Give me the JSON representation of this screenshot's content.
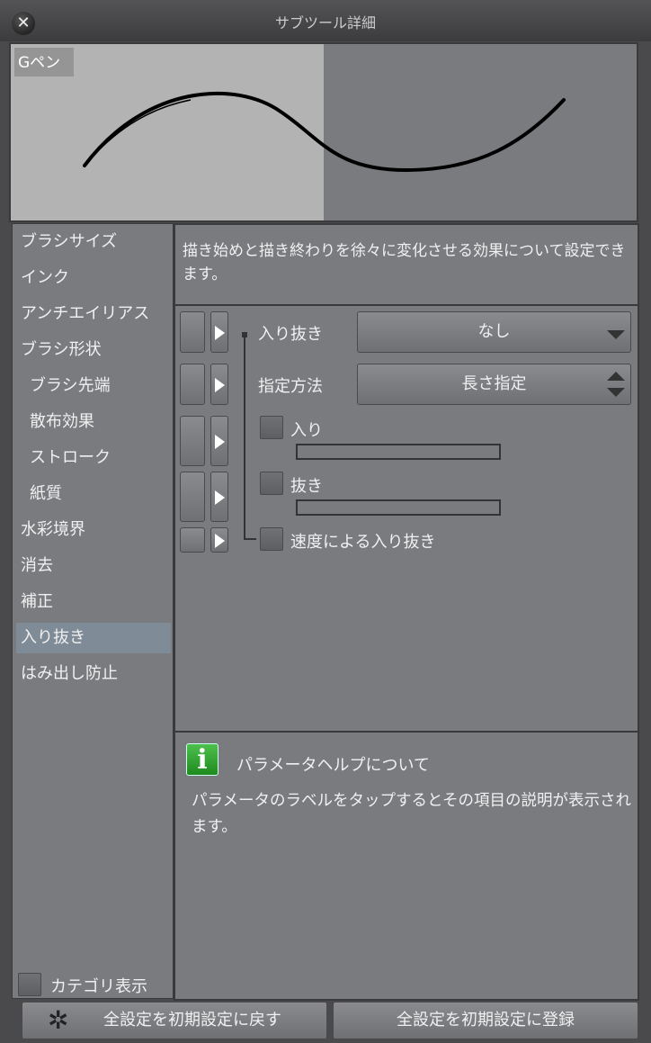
{
  "window": {
    "title": "サブツール詳細"
  },
  "preview": {
    "tool_name": "Gペン"
  },
  "sidebar": {
    "items": [
      {
        "label": "ブラシサイズ",
        "sub": false
      },
      {
        "label": "インク",
        "sub": false
      },
      {
        "label": "アンチエイリアス",
        "sub": false
      },
      {
        "label": "ブラシ形状",
        "sub": false
      },
      {
        "label": "ブラシ先端",
        "sub": true
      },
      {
        "label": "散布効果",
        "sub": true
      },
      {
        "label": "ストローク",
        "sub": true
      },
      {
        "label": "紙質",
        "sub": true
      },
      {
        "label": "水彩境界",
        "sub": false
      },
      {
        "label": "消去",
        "sub": false
      },
      {
        "label": "補正",
        "sub": false
      },
      {
        "label": "入り抜き",
        "sub": false,
        "selected": true
      },
      {
        "label": "はみ出し防止",
        "sub": false
      }
    ],
    "category_label": "カテゴリ表示"
  },
  "description": "描き始めと描き終わりを徐々に変化させる効果について設定できます。",
  "params": {
    "irinuki_label": "入り抜き",
    "irinuki_value": "なし",
    "method_label": "指定方法",
    "method_value": "長さ指定",
    "iri_label": "入り",
    "nuki_label": "抜き",
    "speed_label": "速度による入り抜き"
  },
  "help": {
    "title": "パラメータヘルプについて",
    "body": "パラメータのラベルをタップするとその項目の説明が表示されます。"
  },
  "buttons": {
    "reset": "全設定を初期設定に戻す",
    "register": "全設定を初期設定に登録"
  }
}
